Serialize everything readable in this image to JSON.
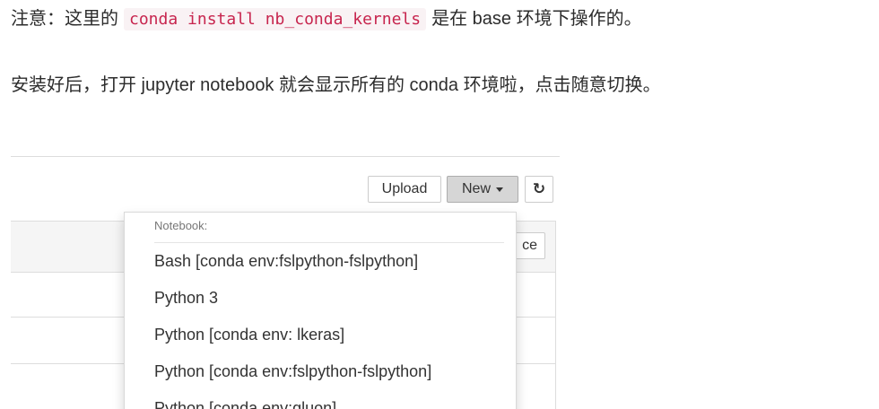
{
  "article": {
    "note_prefix": "注意：这里的",
    "note_code": "conda install nb_conda_kernels",
    "note_suffix": "是在 base 环境下操作的。",
    "install_text": "安装好后，打开 jupyter notebook 就会显示所有的 conda 环境啦，点击随意切换。"
  },
  "toolbar": {
    "upload_label": "Upload",
    "new_label": "New",
    "refresh_icon": "refresh-icon"
  },
  "list": {
    "partial_button_label": "ce"
  },
  "dropdown": {
    "header": "Notebook:",
    "items": [
      "Bash [conda env:fslpython-fslpython]",
      "Python 3",
      "Python [conda env: lkeras]",
      "Python [conda env:fslpython-fslpython]",
      "Python [conda env:gluon]"
    ]
  }
}
